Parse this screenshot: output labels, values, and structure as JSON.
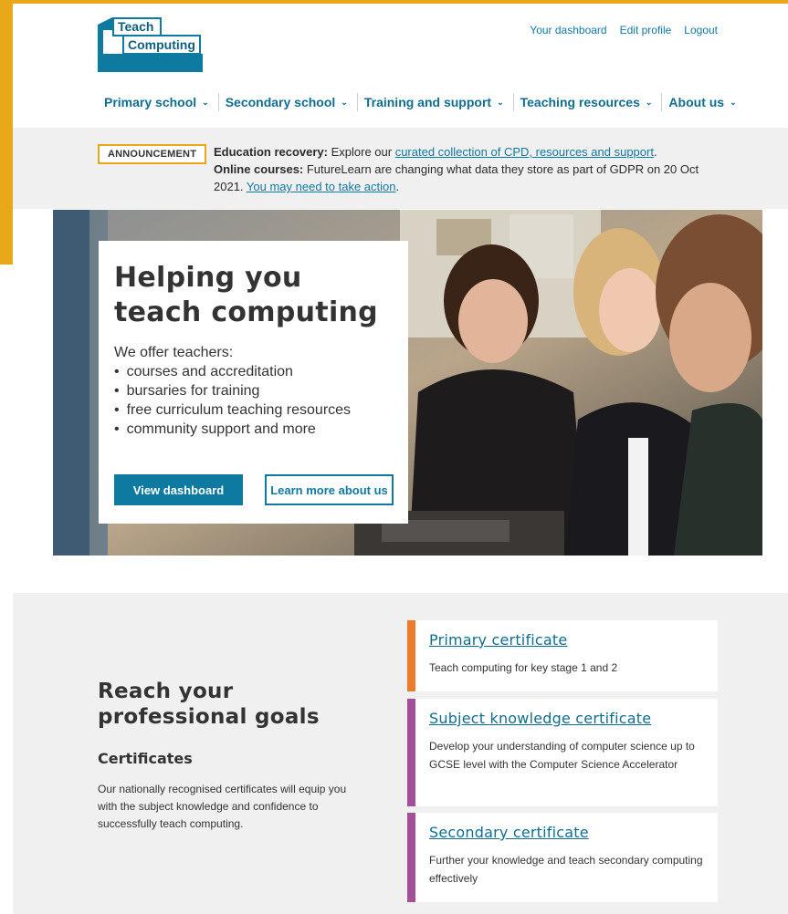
{
  "header": {
    "logo": {
      "line1": "Teach",
      "line2": "Computing"
    },
    "top_links": [
      "Your dashboard",
      "Edit profile",
      "Logout"
    ]
  },
  "nav": [
    {
      "label": "Primary school"
    },
    {
      "label": "Secondary school"
    },
    {
      "label": "Training and support"
    },
    {
      "label": "Teaching resources"
    },
    {
      "label": "About us"
    }
  ],
  "announcement": {
    "badge": "ANNOUNCEMENT",
    "line1_bold": "Education recovery:",
    "line1_text": " Explore our ",
    "line1_link": "curated collection of CPD, resources and support",
    "line1_end": ".",
    "line2_bold": "Online courses:",
    "line2_text": " FutureLearn are changing what data they store as part of GDPR on 20 Oct 2021. ",
    "line2_link": "You may need to take action",
    "line2_end": "."
  },
  "hero": {
    "title": "Helping you teach computing",
    "intro": "We offer teachers:",
    "bullets": [
      "courses and accreditation",
      "bursaries for training",
      "free curriculum teaching resources",
      "community support and more"
    ],
    "primary_button": "View dashboard",
    "secondary_button": "Learn more about us"
  },
  "goals": {
    "heading": "Reach your professional goals",
    "subheading": "Certificates",
    "description": "Our nationally recognised certificates will equip you with the subject knowledge and confidence to successfully teach computing.",
    "certificates": [
      {
        "title": "Primary certificate",
        "text": "Teach computing for key stage 1 and 2",
        "color": "#ea7b2b"
      },
      {
        "title": "Subject knowledge certificate",
        "text": "Develop your understanding of computer science up to GCSE level with the Computer Science Accelerator",
        "color": "#a34f9a"
      },
      {
        "title": "Secondary certificate",
        "text": "Further your knowledge and teach secondary computing effectively",
        "color": "#a34f9a"
      }
    ]
  },
  "colors": {
    "accent": "#0f7aa0",
    "frame": "#e9a819"
  }
}
